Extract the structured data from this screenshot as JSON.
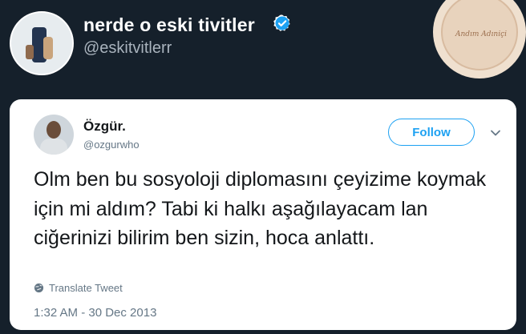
{
  "header": {
    "display_name": "nerde o eski tivitler",
    "handle": "@eskitvitlerr",
    "verified_icon": "verified-badge-icon",
    "badge_text": "Andım Adıniçi"
  },
  "tweet": {
    "author_name": "Özgür.",
    "author_handle": "@ozgurwho",
    "follow_label": "Follow",
    "text": "Olm ben bu sosyoloji diplomasını çeyizime koymak için mi aldım? Tabi ki halkı aşağılayacam lan ciğerinizi bilirim ben sizin, hoca anlattı.",
    "translate_label": "Translate Tweet",
    "timestamp": "1:32 AM - 30 Dec 2013"
  },
  "colors": {
    "background": "#15202b",
    "accent": "#1da1f2",
    "text_primary": "#14171a",
    "text_secondary": "#657786"
  }
}
